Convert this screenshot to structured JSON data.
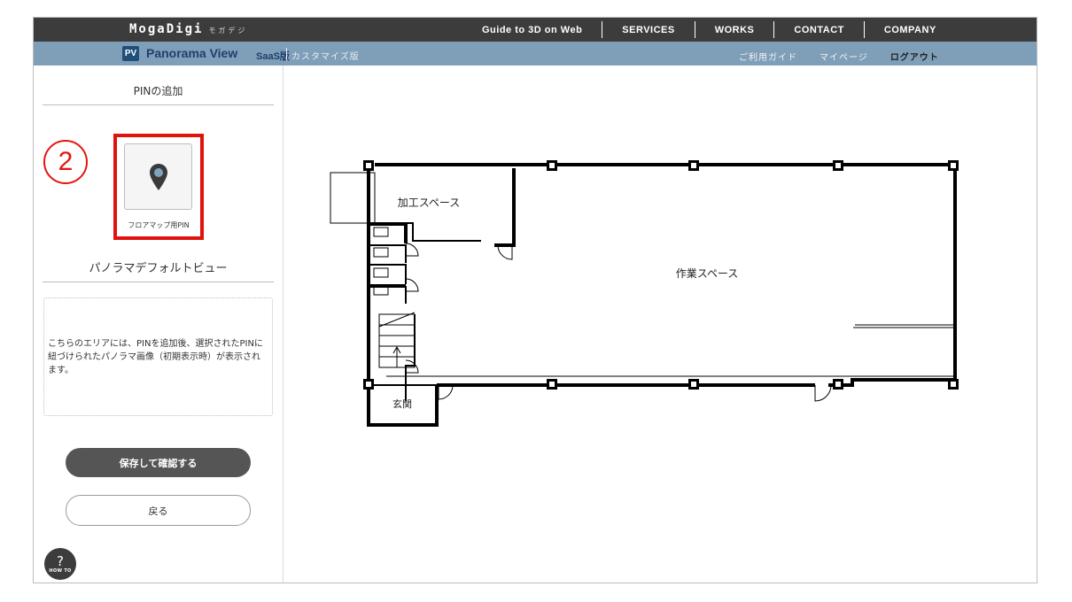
{
  "header": {
    "logo": "MogaDigi",
    "logo_sub": "モガデジ",
    "nav": [
      "Guide to 3D on Web",
      "SERVICES",
      "WORKS",
      "CONTACT",
      "COMPANY"
    ]
  },
  "subheader": {
    "badge": "PV",
    "title": "Panorama View",
    "edition": "SaaS版",
    "custom": "カスタマイズ版",
    "links": [
      "ご利用ガイド",
      "マイページ",
      "ログアウト"
    ]
  },
  "sidebar": {
    "pin_section_title": "PINの追加",
    "step_number": "2",
    "pin_card_label": "フロアマップ用PIN",
    "pin_icon": "map-pin-icon",
    "default_view_title": "パノラマデフォルトビュー",
    "info_text": "こちらのエリアには、PINを追加後、選択されたPINに紐づけられたパノラマ画像（初期表示時）が表示されます。",
    "save_button": "保存して確認する",
    "back_button": "戻る",
    "howto_q": "?",
    "howto_label": "HOW TO"
  },
  "floorplan": {
    "rooms": [
      "加工スペース",
      "作業スペース",
      "玄関"
    ]
  },
  "colors": {
    "topbar": "#3c3c3c",
    "subbar": "#7f9fb9",
    "highlight": "#e0120c",
    "button_dark": "#555555"
  }
}
